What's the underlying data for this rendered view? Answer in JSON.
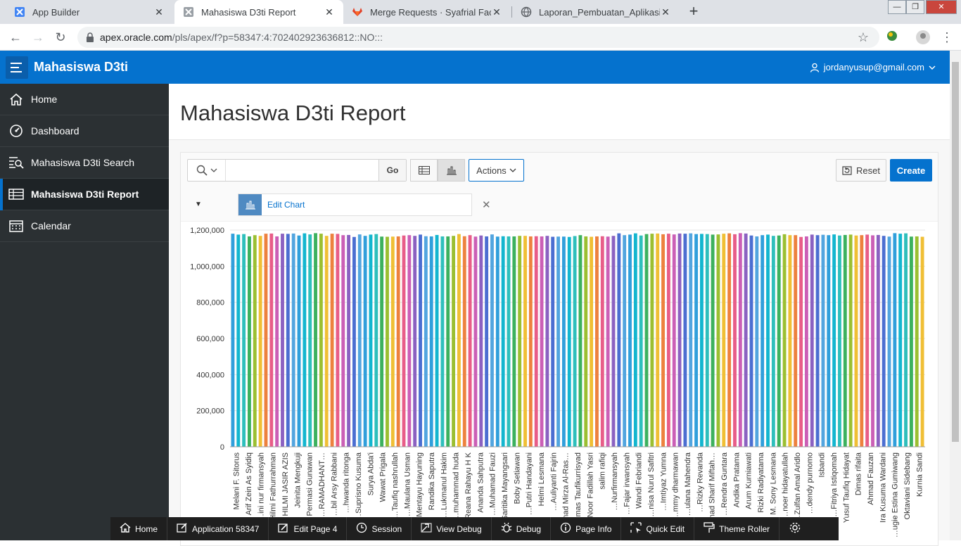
{
  "browser": {
    "tabs": [
      {
        "title": "App Builder",
        "icon": "apex-icon",
        "active": false
      },
      {
        "title": "Mahasiswa D3ti Report",
        "icon": "apex-icon",
        "active": true
      },
      {
        "title": "Merge Requests · Syafrial Fachri R",
        "icon": "gitlab-icon",
        "active": false
      },
      {
        "title": "Laporan_Pembuatan_Aplikasi_D_",
        "icon": "globe-icon",
        "active": false
      }
    ],
    "url_host": "apex.oracle.com",
    "url_path": "/pls/apex/f?p=58347:4:702402923636812::NO:::"
  },
  "app": {
    "title": "Mahasiswa D3ti",
    "user": "jordanyusup@gmail.com",
    "accent_color": "#0572ce"
  },
  "sidebar": {
    "items": [
      {
        "label": "Home",
        "icon": "home-icon",
        "active": false
      },
      {
        "label": "Dashboard",
        "icon": "dashboard-icon",
        "active": false
      },
      {
        "label": "Mahasiswa D3ti Search",
        "icon": "search-report-icon",
        "active": false
      },
      {
        "label": "Mahasiswa D3ti Report",
        "icon": "table-icon",
        "active": true
      },
      {
        "label": "Calendar",
        "icon": "calendar-icon",
        "active": false
      }
    ]
  },
  "page": {
    "title": "Mahasiswa D3ti Report"
  },
  "toolbar": {
    "search_value": "",
    "go_label": "Go",
    "actions_label": "Actions",
    "reset_label": "Reset",
    "create_label": "Create",
    "edit_chart_label": "Edit Chart"
  },
  "chart_data": {
    "type": "bar",
    "ylim": [
      0,
      1200000
    ],
    "yticks": [
      "0",
      "200,000",
      "400,000",
      "600,000",
      "800,000",
      "1,000,000",
      "1,200,000"
    ],
    "grid": true,
    "categories": [
      "Melani F. Sitorus",
      "Arif Zein As Syidiq",
      "…ini nur firmansyah",
      "Hilmi Fathurrahman",
      "HILMI JASIR AZIS",
      "Jeinita Mengkuji",
      "…ri Permasi Gunawan",
      "…RAMADHANT…",
      "…bil Arsy Rabbani",
      "…hwanda ritonga",
      "…Suprisno Kusuma",
      "Surya Abda'i",
      "Wawat Prigala",
      "…Taufiq nashrullah",
      "…Maulana Usman",
      "Mentayu Hayuning",
      "Randika Saputra",
      "…Lukmanul Hakim",
      "…muhammad huda",
      "…Reana Rahayu H K",
      "Ananda Sahputra",
      "…Muhamad Fauzi",
      "…Saritika Mayangsari",
      "Boby Setiawan",
      "…Putri Handayani",
      "Helmi Lesmana",
      "…Auliyanti Fajrin",
      "…ammad Mirza Al-Ras…",
      "Dimas Taufikurrisyad",
      "…Noor Fadillah Yasri",
      "salim rafiqi",
      "…Nurfirmansyah",
      "…Fajar irwansyah",
      "Wandi Febriandi",
      "…nisa Nurul Safitri",
      "…Imtiyaz Yumna",
      "…mmy dharmawan",
      "…ulana Mahendra",
      "…Rizky Revanda",
      "…mad Sharif Miftah…",
      "…Rendra Guntara",
      "Andika Pratama",
      "Arum Kurniawati",
      "Rizki Radiyatama",
      "M. Sony Lesmana",
      "…noer hidayatullah",
      "…Zulfan Amal Aridlo",
      "…dendy purnomo",
      "Isbandi",
      "…Fitriya Istiqomah",
      "Yusuf Taufiq Hidayat",
      "Dimas rifaita",
      "Ahmad Fauzan",
      "Ira Kusuma Wardani",
      "…ugie Estina Gumiwang",
      "Oktaviani Sidebang",
      "Kurnia Sandi"
    ],
    "values": [
      1180000,
      1175000,
      1178000,
      1165000,
      1172000,
      1168000,
      1180000,
      1181000,
      1165000,
      1180000,
      1179000,
      1181000,
      1170000,
      1182000,
      1176000,
      1183000,
      1180000,
      1168000,
      1180000,
      1179000,
      1172000,
      1173000,
      1162000,
      1176000,
      1168000,
      1175000,
      1178000,
      1164000,
      1163000,
      1164000,
      1165000,
      1170000,
      1172000,
      1168000,
      1175000,
      1166000,
      1165000,
      1173000,
      1165000,
      1165000,
      1168000,
      1178000,
      1166000,
      1172000,
      1164000,
      1170000,
      1165000,
      1176000,
      1164000,
      1166000,
      1165000,
      1165000,
      1168000,
      1168000,
      1165000,
      1166000,
      1165000,
      1168000,
      1163000,
      1164000,
      1164000,
      1162000,
      1167000,
      1172000,
      1165000,
      1163000,
      1165000,
      1166000,
      1164000,
      1168000,
      1182000,
      1172000,
      1175000,
      1182000,
      1170000,
      1178000,
      1180000,
      1181000,
      1177000,
      1180000,
      1176000,
      1181000,
      1180000,
      1182000,
      1178000,
      1179000,
      1178000,
      1175000,
      1176000,
      1180000,
      1182000,
      1177000,
      1183000,
      1181000,
      1170000,
      1165000,
      1172000,
      1175000,
      1168000,
      1170000,
      1177000,
      1172000,
      1172000,
      1162000,
      1165000,
      1175000,
      1172000,
      1174000,
      1172000,
      1176000,
      1170000,
      1173000,
      1175000,
      1170000,
      1172000,
      1175000,
      1171000,
      1173000,
      1168000,
      1164000,
      1183000,
      1180000,
      1182000,
      1164000,
      1165000,
      1163000
    ],
    "bar_colors": [
      "#309fdb",
      "#13b6cf",
      "#2ebfbc",
      "#3cb15e",
      "#9bbf31",
      "#f0bf35",
      "#ed813e",
      "#e85d88",
      "#cb5fb6",
      "#8b61c1",
      "#4b6ed1",
      "#52a5df"
    ]
  },
  "devbar": {
    "items": [
      {
        "label": "Home",
        "icon": "home-icon"
      },
      {
        "label": "Application 58347",
        "icon": "edit-icon"
      },
      {
        "label": "Edit Page 4",
        "icon": "edit-page-icon"
      },
      {
        "label": "Session",
        "icon": "clock-icon"
      },
      {
        "label": "View Debug",
        "icon": "view-debug-icon"
      },
      {
        "label": "Debug",
        "icon": "bug-icon"
      },
      {
        "label": "Page Info",
        "icon": "info-icon"
      },
      {
        "label": "Quick Edit",
        "icon": "quick-edit-icon"
      },
      {
        "label": "Theme Roller",
        "icon": "paint-roller-icon"
      },
      {
        "label": "",
        "icon": "gear-icon"
      }
    ]
  }
}
